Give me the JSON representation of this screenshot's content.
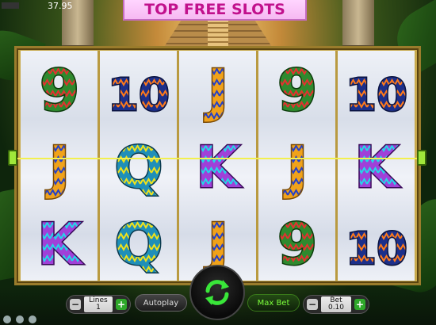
{
  "header": {
    "balance": "37.95",
    "title": "TOP FREE SLOTS"
  },
  "reels": [
    [
      "9",
      "10",
      "J",
      "9",
      "10"
    ],
    [
      "J",
      "Q",
      "K",
      "J",
      "K"
    ],
    [
      "K",
      "Q",
      "J",
      "9",
      "10"
    ]
  ],
  "controls": {
    "lines_label": "Lines",
    "lines_value": "1",
    "autoplay_label": "Autoplay",
    "maxbet_label": "Max Bet",
    "bet_label": "Bet",
    "bet_value": "0.10",
    "minus": "−",
    "plus": "+"
  },
  "colors": {
    "title_text": "#c1118c",
    "title_bg": "#f6b9f2",
    "frame": "#c8aa4e",
    "payline": "#f3f04f",
    "spin_arrows": "#39e639"
  },
  "icons": {
    "spin": "refresh-arrows-icon",
    "payline_marker": "payline-marker-icon"
  }
}
